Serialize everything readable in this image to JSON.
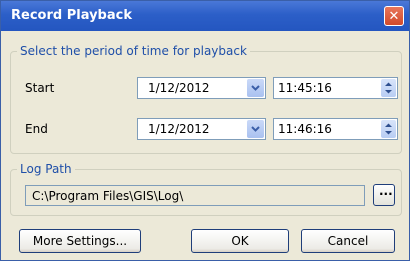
{
  "window": {
    "title": "Record Playback"
  },
  "period": {
    "legend": "Select the period of time for playback",
    "start": {
      "label": "Start",
      "date": "1/12/2012",
      "time": "11:45:16"
    },
    "end": {
      "label": "End",
      "date": "1/12/2012",
      "time": "11:46:16"
    }
  },
  "log": {
    "legend": "Log Path",
    "path": "C:\\Program Files\\GIS\\Log\\",
    "browse_label": "..."
  },
  "buttons": {
    "more_settings": "More Settings...",
    "ok": "OK",
    "cancel": "Cancel"
  },
  "colors": {
    "accent": "#1f4fa8",
    "titlebar": "#2c5fc8",
    "close": "#d24a2a"
  },
  "icons": {
    "close": "close-icon",
    "dropdown": "chevron-down-icon",
    "spin": "spin-arrows-icon"
  }
}
